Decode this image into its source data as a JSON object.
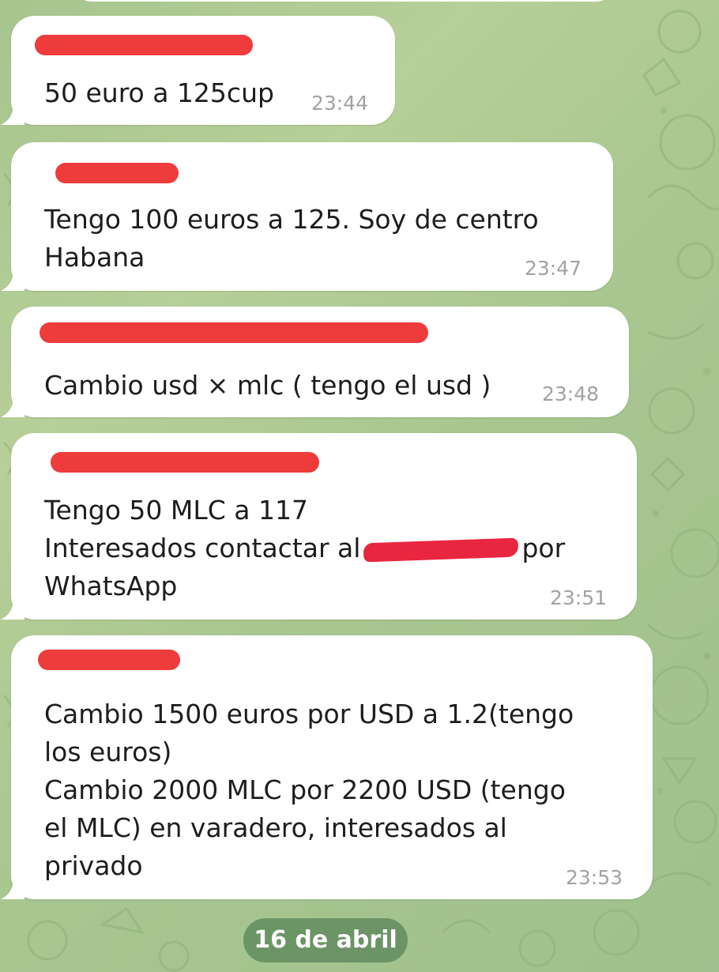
{
  "messages": [
    {
      "lines": [
        "50 euro a 125cup"
      ],
      "time": "23:44"
    },
    {
      "lines": [
        "Tengo 100 euros a 125. Soy de centro",
        "Habana"
      ],
      "time": "23:47"
    },
    {
      "lines": [
        "Cambio usd × mlc ( tengo el usd )"
      ],
      "time": "23:48"
    },
    {
      "lines": [
        "Tengo 50 MLC a 117"
      ],
      "line2_prefix": "Interesados contactar al",
      "line2_suffix": "por",
      "line3": "WhatsApp",
      "time": "23:51"
    },
    {
      "lines": [
        "Cambio 1500 euros por USD a 1.2(tengo",
        "los euros)",
        "Cambio 2000 MLC por 2200 USD (tengo",
        "el MLC) en varadero, interesados al",
        "privado"
      ],
      "time": "23:53"
    }
  ],
  "date_separator": "16 de abril",
  "colors": {
    "bubble": "#ffffff",
    "time_text": "#a2a2a2",
    "redaction": "#ee3b3b",
    "date_pill": "#5a8a5c"
  }
}
